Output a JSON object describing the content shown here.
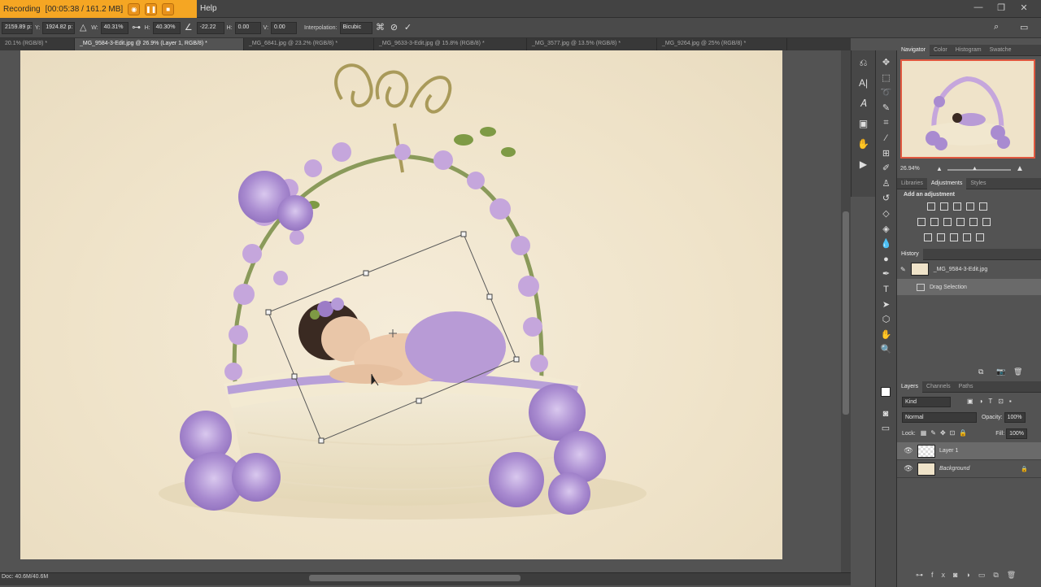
{
  "recording": {
    "label": "Recording",
    "time": "[00:05:38 / 161.2 MB]"
  },
  "menu": {
    "help": "Help"
  },
  "options": {
    "x_value": "2159.89 p:",
    "y_label": "Y:",
    "y_value": "1924.82 p:",
    "w_label": "W:",
    "w_value": "40.31%",
    "h_label": "H:",
    "h_value": "40.30%",
    "angle_value": "-22.22",
    "hs_label": "H:",
    "hs_value": "0.00",
    "vs_label": "V:",
    "vs_value": "0.00",
    "interp_label": "Interpolation:",
    "interp_value": "Bicubic"
  },
  "tabs": [
    "20.1% (RGB/8) *",
    "_MG_9584-3-Edit.jpg @ 26.9% (Layer 1, RGB/8) *",
    "_MG_6841.jpg @ 23.2% (RGB/8) *",
    "_MG_9633-3-Edit.jpg @ 15.8% (RGB/8) *",
    "_MG_3577.jpg @ 13.5% (RGB/8) *",
    "_MG_9264.jpg @ 25% (RGB/8) *"
  ],
  "status": {
    "doc": "Doc: 40.6M/40.6M"
  },
  "navigator": {
    "tabs": [
      "Navigator",
      "Color",
      "Histogram",
      "Swatche"
    ],
    "zoom": "26.94%"
  },
  "adjustments": {
    "tabs": [
      "Libraries",
      "Adjustments",
      "Styles"
    ],
    "heading": "Add an adjustment"
  },
  "history": {
    "tab": "History",
    "items": [
      "_MG_9584-3-Edit.jpg",
      "Drag Selection"
    ]
  },
  "layers": {
    "tabs": [
      "Layers",
      "Channels",
      "Paths"
    ],
    "kind": "Kind",
    "blend_mode": "Normal",
    "opacity_label": "Opacity:",
    "opacity_value": "100%",
    "lock_label": "Lock:",
    "fill_label": "Fill:",
    "fill_value": "100%",
    "items": [
      "Layer 1",
      "Background"
    ]
  },
  "colors": {
    "accent": "#f5a623",
    "nav_frame": "#e0583f",
    "flower": "#b49ad6"
  }
}
